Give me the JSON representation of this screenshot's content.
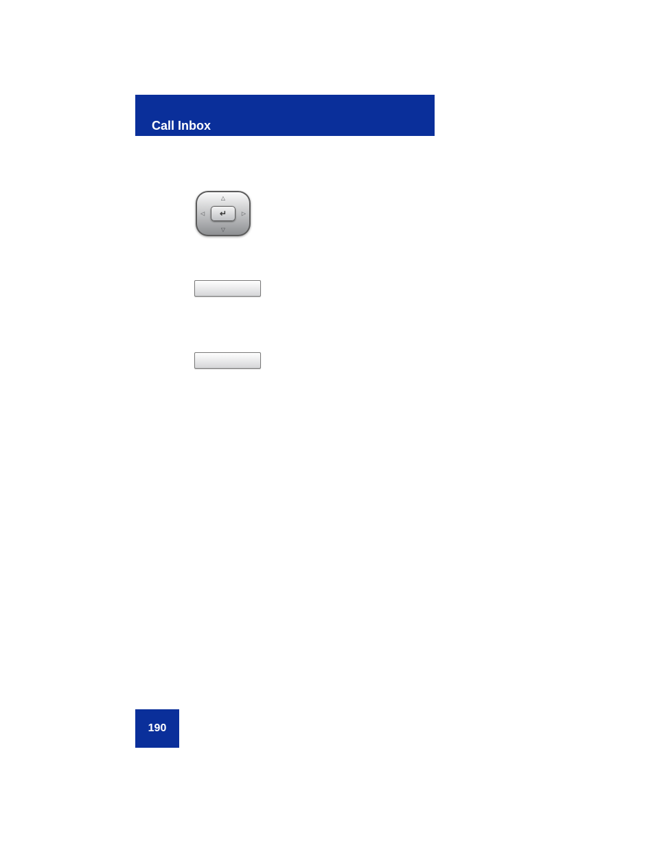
{
  "header": {
    "title": "Call Inbox"
  },
  "icons": {
    "dpad_name": "navigation-key-icon",
    "enter_glyph": "↵"
  },
  "steps": {
    "softkey1_label": "",
    "softkey2_label": ""
  },
  "page_number": "190"
}
